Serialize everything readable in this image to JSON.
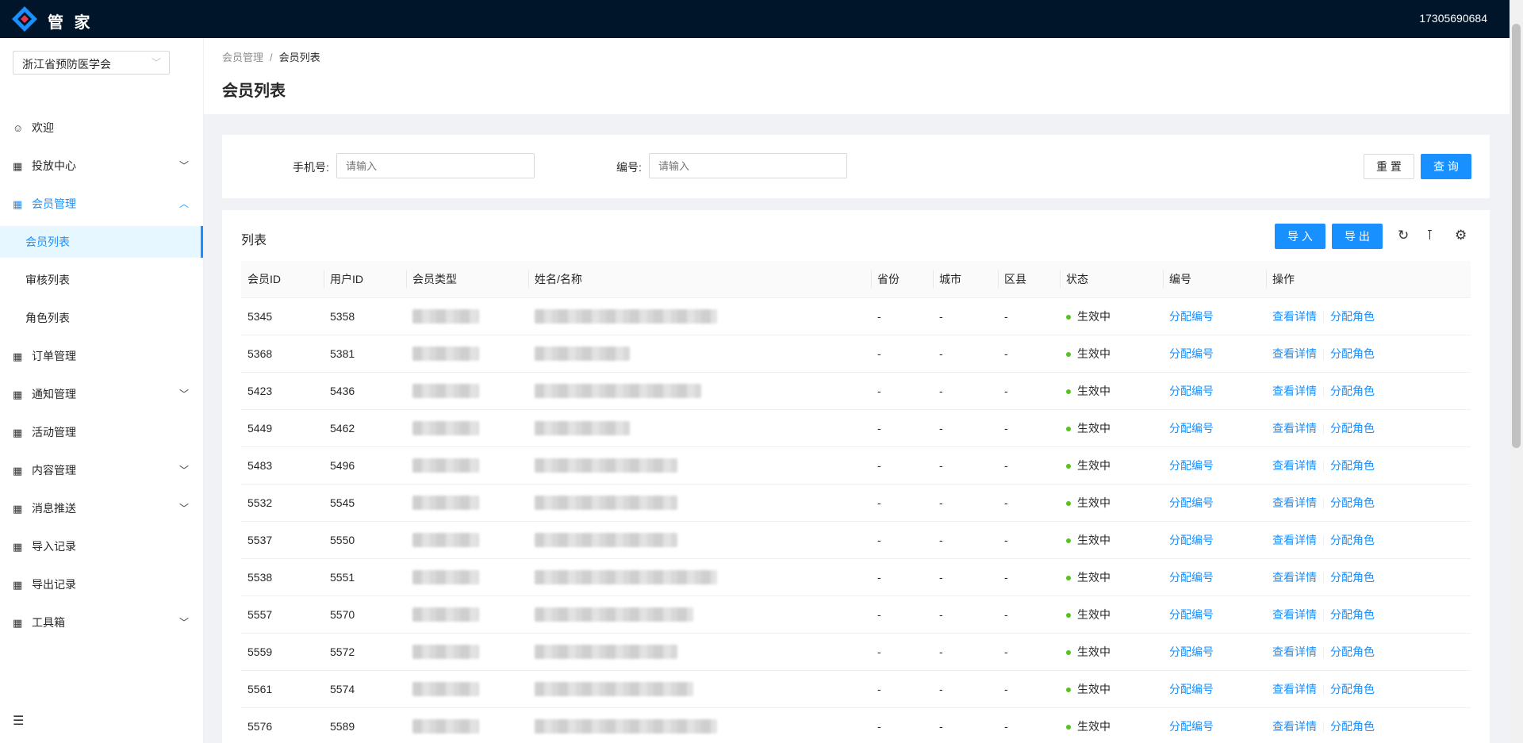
{
  "header": {
    "brand": "管 家",
    "user_phone": "17305690684"
  },
  "sidebar": {
    "org": "浙江省预防医学会",
    "items": [
      {
        "label": "欢迎",
        "icon": "smile-icon"
      },
      {
        "label": "投放中心",
        "icon": "table-icon",
        "arrow": "down"
      },
      {
        "label": "会员管理",
        "icon": "table-icon",
        "arrow": "up"
      },
      {
        "label": "会员列表"
      },
      {
        "label": "审核列表"
      },
      {
        "label": "角色列表"
      },
      {
        "label": "订单管理",
        "icon": "table-icon"
      },
      {
        "label": "通知管理",
        "icon": "table-icon",
        "arrow": "down"
      },
      {
        "label": "活动管理",
        "icon": "table-icon"
      },
      {
        "label": "内容管理",
        "icon": "table-icon",
        "arrow": "down"
      },
      {
        "label": "消息推送",
        "icon": "table-icon",
        "arrow": "down"
      },
      {
        "label": "导入记录",
        "icon": "table-icon"
      },
      {
        "label": "导出记录",
        "icon": "table-icon"
      },
      {
        "label": "工具箱",
        "icon": "table-icon",
        "arrow": "down"
      }
    ]
  },
  "breadcrumb": [
    "会员管理",
    "会员列表"
  ],
  "page_title": "会员列表",
  "search": {
    "phone_label": "手机号:",
    "phone_placeholder": "请输入",
    "number_label": "编号:",
    "number_placeholder": "请输入",
    "reset": "重 置",
    "query": "查 询"
  },
  "table": {
    "title": "列表",
    "import": "导 入",
    "export": "导 出",
    "columns": [
      "会员ID",
      "用户ID",
      "会员类型",
      "姓名/名称",
      "省份",
      "城市",
      "区县",
      "状态",
      "编号",
      "操作"
    ],
    "rows": [
      {
        "member_id": "5345",
        "user_id": "5358",
        "province": "-",
        "city": "-",
        "district": "-",
        "status": "生效中"
      },
      {
        "member_id": "5368",
        "user_id": "5381",
        "province": "-",
        "city": "-",
        "district": "-",
        "status": "生效中"
      },
      {
        "member_id": "5423",
        "user_id": "5436",
        "province": "-",
        "city": "-",
        "district": "-",
        "status": "生效中"
      },
      {
        "member_id": "5449",
        "user_id": "5462",
        "province": "-",
        "city": "-",
        "district": "-",
        "status": "生效中"
      },
      {
        "member_id": "5483",
        "user_id": "5496",
        "province": "-",
        "city": "-",
        "district": "-",
        "status": "生效中"
      },
      {
        "member_id": "5532",
        "user_id": "5545",
        "province": "-",
        "city": "-",
        "district": "-",
        "status": "生效中"
      },
      {
        "member_id": "5537",
        "user_id": "5550",
        "province": "-",
        "city": "-",
        "district": "-",
        "status": "生效中"
      },
      {
        "member_id": "5538",
        "user_id": "5551",
        "province": "-",
        "city": "-",
        "district": "-",
        "status": "生效中"
      },
      {
        "member_id": "5557",
        "user_id": "5570",
        "province": "-",
        "city": "-",
        "district": "-",
        "status": "生效中"
      },
      {
        "member_id": "5559",
        "user_id": "5572",
        "province": "-",
        "city": "-",
        "district": "-",
        "status": "生效中"
      },
      {
        "member_id": "5561",
        "user_id": "5574",
        "province": "-",
        "city": "-",
        "district": "-",
        "status": "生效中"
      },
      {
        "member_id": "5576",
        "user_id": "5589",
        "province": "-",
        "city": "-",
        "district": "-",
        "status": "生效中"
      }
    ],
    "assign_number": "分配编号",
    "view_detail": "查看详情",
    "assign_role": "分配角色"
  },
  "colors": {
    "primary": "#1890ff",
    "header_bg": "#001529",
    "status_active": "#52c41a"
  }
}
